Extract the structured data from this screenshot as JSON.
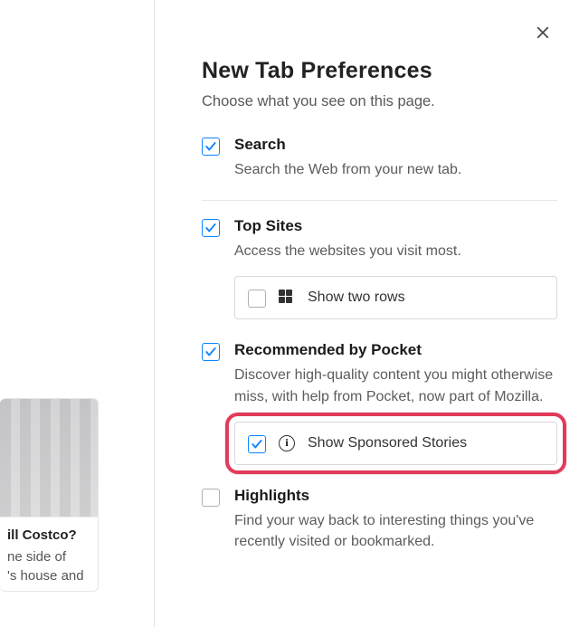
{
  "panel": {
    "title": "New Tab Preferences",
    "subtitle": "Choose what you see on this page."
  },
  "sections": {
    "search": {
      "checked": true,
      "heading": "Search",
      "desc": "Search the Web from your new tab."
    },
    "topsites": {
      "checked": true,
      "heading": "Top Sites",
      "desc": "Access the websites you visit most.",
      "sub": {
        "checked": false,
        "label": "Show two rows"
      }
    },
    "pocket": {
      "checked": true,
      "heading": "Recommended by Pocket",
      "desc": "Discover high-quality content you might otherwise miss, with help from Pocket, now part of Mozilla.",
      "sub": {
        "checked": true,
        "label": "Show Sponsored Stories"
      }
    },
    "highlights": {
      "checked": false,
      "heading": "Highlights",
      "desc": "Find your way back to interesting things you've recently visited or bookmarked."
    }
  },
  "left_card": {
    "title_fragment": "ill Costco?",
    "line1_fragment": "ne side of",
    "line2_fragment": "'s house and"
  }
}
